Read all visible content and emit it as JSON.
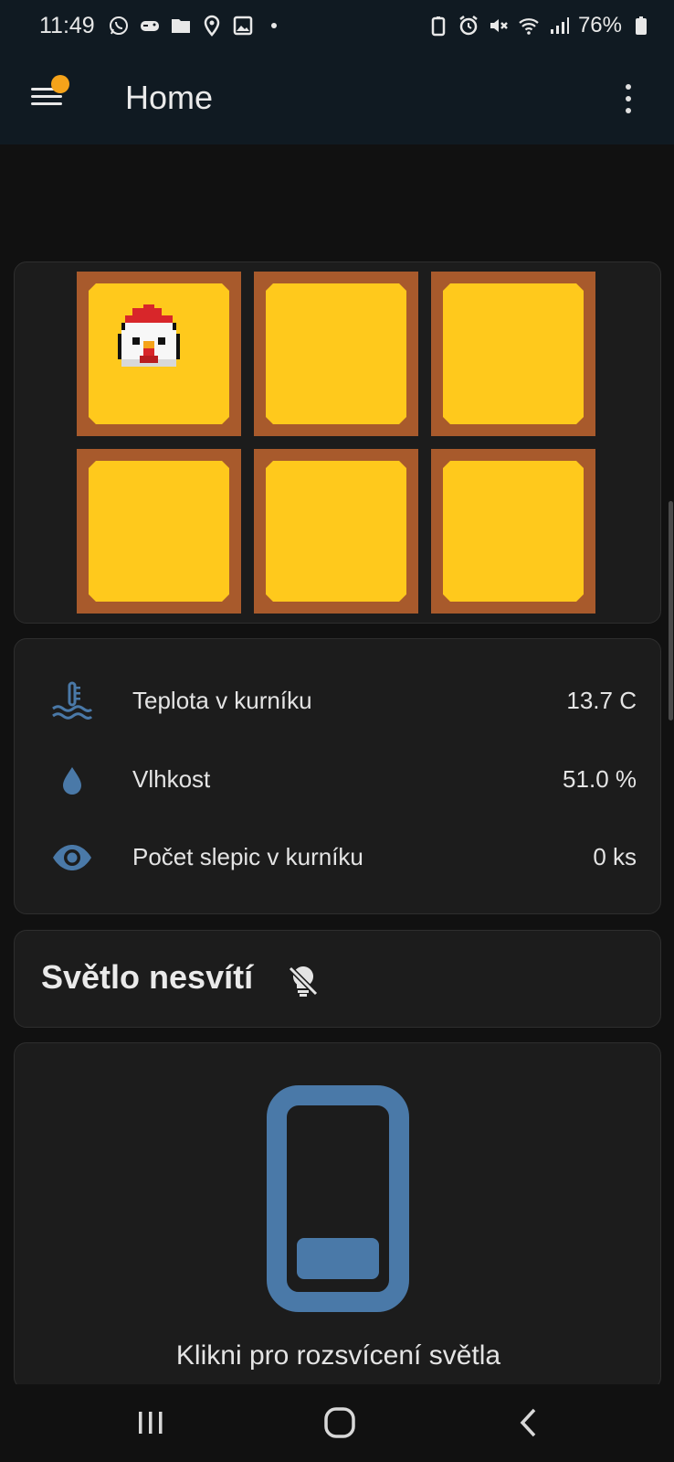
{
  "status_bar": {
    "time": "11:49",
    "battery": "76%",
    "left_icons": [
      "whatsapp-icon",
      "game-controller-icon",
      "folder-icon",
      "location-pin-icon",
      "image-icon",
      "dot-icon"
    ],
    "right_icons": [
      "battery-saver-icon",
      "alarm-icon",
      "mute-icon",
      "wifi-icon",
      "signal-icon",
      "battery-icon"
    ]
  },
  "app_bar": {
    "title": "Home",
    "notification_dot_color": "#f5a31a"
  },
  "coop_grid": {
    "tiles": [
      {
        "occupied": true
      },
      {
        "occupied": false
      },
      {
        "occupied": false
      },
      {
        "occupied": false
      },
      {
        "occupied": false
      },
      {
        "occupied": false
      }
    ],
    "tile_color": "#ffc91c",
    "frame_color": "#a85a2c"
  },
  "sensors": [
    {
      "icon": "coolant-temperature-icon",
      "label": "Teplota v kurníku",
      "value": "13.7 C"
    },
    {
      "icon": "water-drop-icon",
      "label": "Vlhkost",
      "value": "51.0 %"
    },
    {
      "icon": "eye-icon",
      "label": "Počet slepic v kurníku",
      "value": "0 ks"
    }
  ],
  "light_status": {
    "text": "Světlo nesvítí",
    "icon": "lightbulb-off-icon"
  },
  "light_switch": {
    "icon": "phone-toggle-icon",
    "caption": "Klikni pro rozsvícení světla"
  },
  "accent_color": "#4a79a8",
  "nav_bar": {
    "buttons": [
      "recent-apps-icon",
      "home-icon",
      "back-icon"
    ]
  }
}
